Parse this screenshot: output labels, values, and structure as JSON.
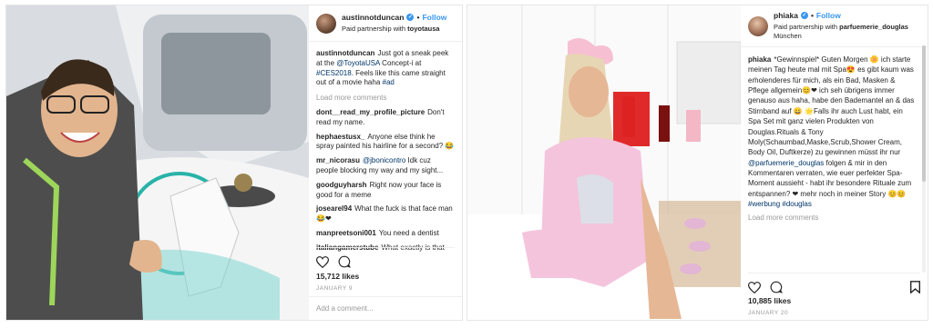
{
  "post1": {
    "username": "austinnotduncan",
    "follow_label": "Follow",
    "partnership_prefix": "Paid partnership with ",
    "partner": "toyotausa",
    "caption_user": "austinnotduncan",
    "caption_1": "Just got a sneak peek at the ",
    "caption_mention": "@ToyotaUSA",
    "caption_2": " Concept-i at ",
    "caption_tag1": "#CES2018",
    "caption_3": ". Feels like this came straight out of a movie haha ",
    "caption_tag2": "#ad",
    "load_more": "Load more comments",
    "comments": [
      {
        "user": "dont__read_my_profile_picture",
        "text": "Don't read my name."
      },
      {
        "user": "hephaestusx_",
        "text": "Anyone else think he spray painted his hairline for a second? 😂"
      },
      {
        "user": "mr_nicorasu",
        "mention": "@jbonicontro",
        "text": " Idk cuz people blocking my way and my sight..."
      },
      {
        "user": "goodguyharsh",
        "text": "Right now your face is good for a meme"
      },
      {
        "user": "josearel94",
        "text": "What the fuck is that face man 😂❤"
      },
      {
        "user": "manpreetsoni001",
        "text": "You need a dentist"
      },
      {
        "user": "italiangamerstube",
        "text": "What exactly is that"
      }
    ],
    "likes": "15,712 likes",
    "date": "JANUARY 9",
    "add_comment_placeholder": "Add a comment..."
  },
  "post2": {
    "username": "phiaka",
    "follow_label": "Follow",
    "partnership_prefix": "Paid partnership with ",
    "partner": "parfuemerie_douglas",
    "location": "München",
    "caption_user": "phiaka",
    "caption_1": "*Gewinnspiel* Guten Morgen 🌼 ich starte meinen Tag heute mal mit Spa😍 es gibt kaum was erholenderes für mich, als ein Bad, Masken & Pflege allgemein😊❤ ich seh übrigens immer genauso aus haha, habe den Bademantel an & das Stirnband auf 😀 🌟Falls ihr auch Lust habt, ein Spa Set mit ganz vielen Produkten von Douglas.Rituals & Tony Moly(Schaumbad,Maske,Scrub,Shower Cream, Body Oil, Duftkerze) zu gewinnen müsst ihr nur ",
    "caption_mention": "@parfuemerie_douglas",
    "caption_2": " folgen & mir in den Kommentaren verraten, wie euer perfekter Spa- Moment aussieht - habt ihr besondere Rituale zum entspannen? ❤ mehr noch in meiner Story 😊😊 ",
    "caption_tag1": "#werbung",
    "caption_tag2": "#douglas",
    "load_more": "Load more comments",
    "likes": "10,885 likes",
    "date": "JANUARY 20"
  }
}
